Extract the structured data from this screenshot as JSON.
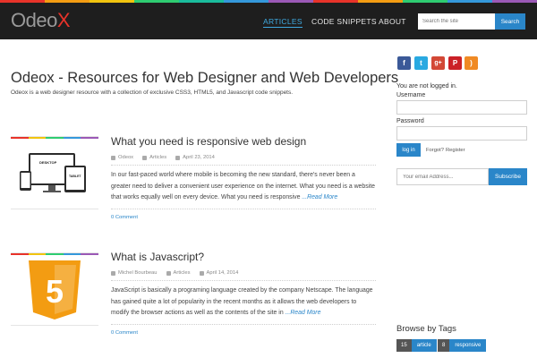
{
  "colors": {
    "header_bg": "#1e1e1e",
    "accent": "#2a86c9",
    "logo_x": "#e8332a",
    "stripe": [
      "#e8332a",
      "#f39c12",
      "#f1c40f",
      "#2ecc71",
      "#1abc9c",
      "#3498db",
      "#9b59b6",
      "#e8332a",
      "#f39c12",
      "#2ecc71",
      "#3498db",
      "#9b59b6"
    ]
  },
  "header": {
    "logo_main": "Odeo",
    "logo_x": "X",
    "nav": [
      "ARTICLES",
      "CODE SNIPPETS",
      "ABOUT"
    ],
    "active_nav": "ARTICLES",
    "search_placeholder": "Search the site",
    "search_button": "Search"
  },
  "site": {
    "title": "Odeox - Resources for Web Designer and Web Developers",
    "description": "Odeox is a web designer resource with a collection of exclusive CSS3, HTML5, and Javascript code snippets."
  },
  "posts": [
    {
      "title": "What you need is responsive web design",
      "author": "Odeox",
      "category": "Articles",
      "date": "April 23, 2014",
      "excerpt": "In our fast-paced world where mobile is becoming the new standard, there's never been a greater need to deliver a convenient user experience on the internet. What you need is a website that works equally well on every device. What you need is responsive",
      "read_more": "...Read More",
      "comments": "0 Comment",
      "thumb_labels": [
        "DESKTOP",
        "TABLET"
      ]
    },
    {
      "title": "What is Javascript?",
      "author": "Michel Bourbeau",
      "category": "Articles",
      "date": "April 14, 2014",
      "excerpt": "JavaScript is basically a programing language created by the company Netscape. The language has gained quite a lot of popularity in the recent months as it allows the web developers to modify the browser actions as well as the contents of the site in",
      "read_more": "...Read More",
      "comments": "0 Comment",
      "thumb_labels": [
        "5"
      ]
    }
  ],
  "sidebar": {
    "social_icons": [
      "facebook-icon",
      "twitter-icon",
      "google-plus-icon",
      "pinterest-icon",
      "rss-icon"
    ],
    "social_glyphs": [
      "f",
      "t",
      "g+",
      "P",
      ")"
    ],
    "not_logged_in": "You are not logged in.",
    "username_label": "Username",
    "password_label": "Password",
    "login_button": "log in",
    "forgot_link": "Forgot?",
    "register_link": "Register",
    "email_placeholder": "Your email Address...",
    "subscribe_button": "Subscribe",
    "tags_title": "Browse by Tags",
    "tags": [
      {
        "count": "15",
        "name": "article"
      },
      {
        "count": "8",
        "name": "responsive"
      }
    ]
  }
}
